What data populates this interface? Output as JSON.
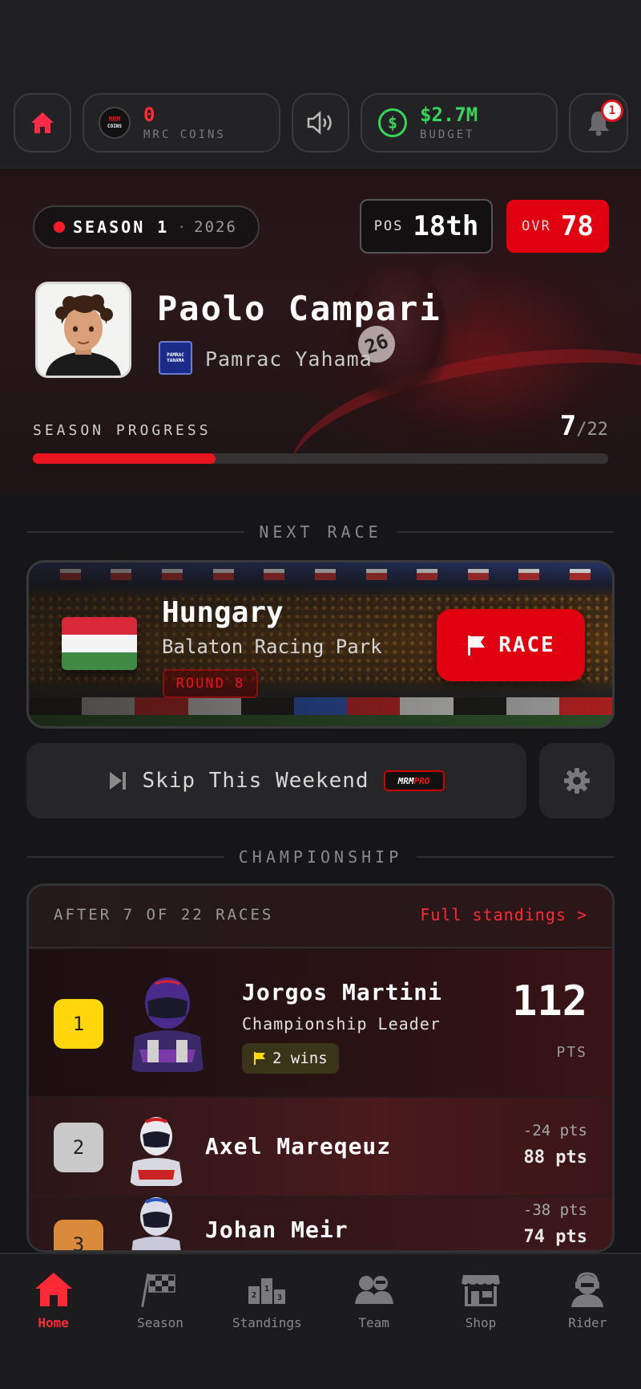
{
  "topbar": {
    "coins": {
      "value": "0",
      "label": "MRC COINS",
      "logo_top": "MRM",
      "logo_bottom": "COINS"
    },
    "budget": {
      "value": "$2.7M",
      "label": "BUDGET"
    },
    "notifications": {
      "count": "1"
    },
    "icons": [
      "home-icon",
      "sound-icon",
      "dollar-icon",
      "bell-icon"
    ]
  },
  "hero": {
    "season_label": "SEASON 1",
    "season_sep": "·",
    "season_year": "2026",
    "pos_label": "POS",
    "pos_value": "18th",
    "ovr_label": "OVR",
    "ovr_value": "78",
    "bike_number": "26",
    "rider_name": "Paolo Campari",
    "team_name": "Pamrac Yahama",
    "team_logo_top": "PAMRAC",
    "team_logo_bottom": "YAHAMA",
    "progress_label": "SEASON PROGRESS",
    "progress_current": "7",
    "progress_total": "/22",
    "progress_fraction": 0.318
  },
  "next_race": {
    "section_title": "NEXT RACE",
    "country": "Hungary",
    "circuit": "Balaton Racing Park",
    "round": "ROUND 8",
    "race_button": "RACE",
    "skip_button": "Skip This Weekend",
    "pro_logo_a": "MRM",
    "pro_logo_b": "PRO"
  },
  "championship": {
    "section_title": "CHAMPIONSHIP",
    "after_text": "AFTER 7 OF 22 RACES",
    "full_link": "Full standings >",
    "leader": {
      "rank": "1",
      "name": "Jorgos Martini",
      "subtitle": "Championship Leader",
      "wins": "2 wins",
      "points": "112",
      "points_label": "PTS"
    },
    "rows": [
      {
        "rank": "2",
        "name": "Axel Mareqeuz",
        "gap": "-24 pts",
        "points": "88 pts"
      },
      {
        "rank": "3",
        "name": "Johan Meir",
        "gap": "-38 pts",
        "points": "74 pts"
      }
    ]
  },
  "nav": {
    "items": [
      {
        "label": "Home",
        "icon": "home-icon"
      },
      {
        "label": "Season",
        "icon": "checkered-flag-icon"
      },
      {
        "label": "Standings",
        "icon": "podium-icon"
      },
      {
        "label": "Team",
        "icon": "team-icon"
      },
      {
        "label": "Shop",
        "icon": "shop-icon"
      },
      {
        "label": "Rider",
        "icon": "rider-icon"
      }
    ],
    "active": "Home"
  },
  "colors": {
    "accent": "#e0000f",
    "budget_green": "#39d45a",
    "gold": "#ffd60a",
    "silver": "#c9c9c9",
    "bronze": "#d98a3a"
  }
}
